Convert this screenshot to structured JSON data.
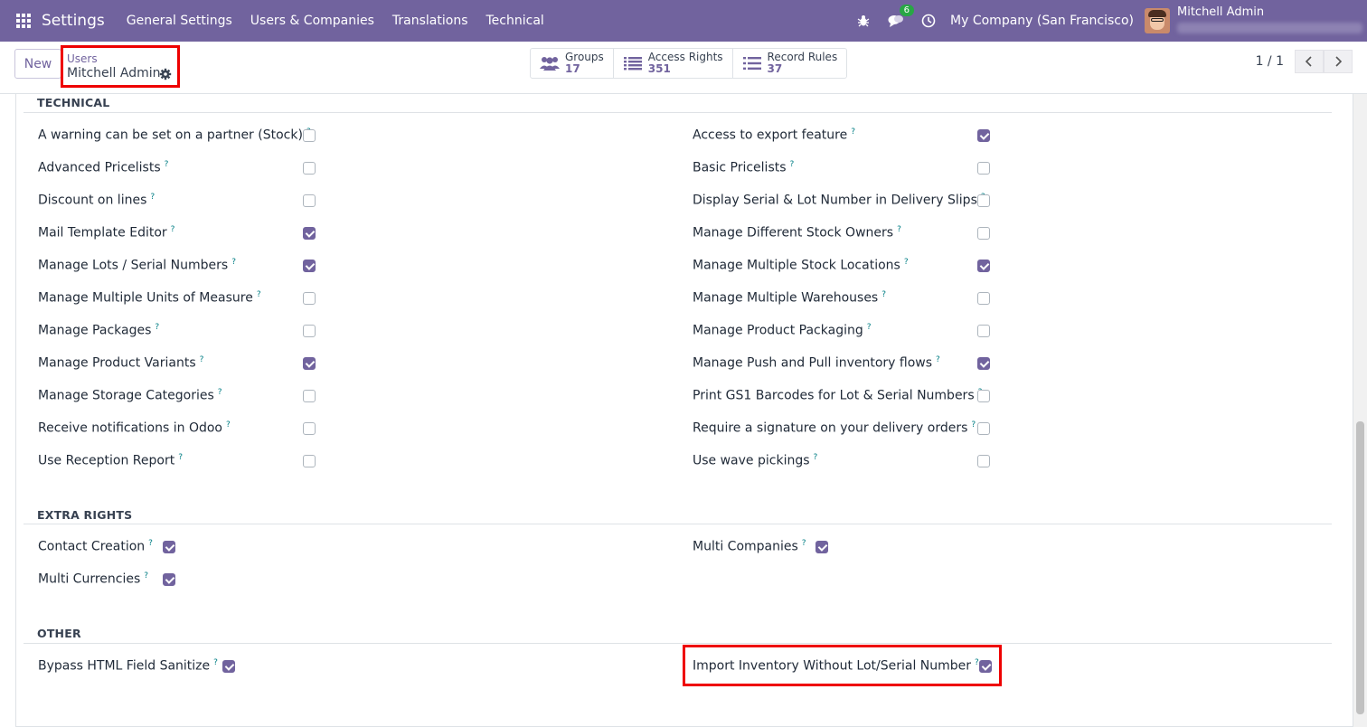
{
  "navbar": {
    "brand": "Settings",
    "menu": [
      "General Settings",
      "Users & Companies",
      "Translations",
      "Technical"
    ],
    "messages_badge": "6",
    "company": "My Company (San Francisco)",
    "user": "Mitchell Admin"
  },
  "control_panel": {
    "new_label": "New",
    "breadcrumb_parent": "Users",
    "breadcrumb_current": "Mitchell Admin",
    "smart_buttons": [
      {
        "label": "Groups",
        "value": "17",
        "icon": "users-icon"
      },
      {
        "label": "Access Rights",
        "value": "351",
        "icon": "list-icon"
      },
      {
        "label": "Record Rules",
        "value": "37",
        "icon": "list-icon"
      }
    ],
    "pager": "1 / 1"
  },
  "sections": {
    "technical": {
      "title": "TECHNICAL",
      "left": [
        {
          "label": "A warning can be set on a partner (Stock)",
          "checked": false
        },
        {
          "label": "Advanced Pricelists",
          "checked": false
        },
        {
          "label": "Discount on lines",
          "checked": false
        },
        {
          "label": "Mail Template Editor",
          "checked": true
        },
        {
          "label": "Manage Lots / Serial Numbers",
          "checked": true
        },
        {
          "label": "Manage Multiple Units of Measure",
          "checked": false
        },
        {
          "label": "Manage Packages",
          "checked": false
        },
        {
          "label": "Manage Product Variants",
          "checked": true
        },
        {
          "label": "Manage Storage Categories",
          "checked": false
        },
        {
          "label": "Receive notifications in Odoo",
          "checked": false
        },
        {
          "label": "Use Reception Report",
          "checked": false
        }
      ],
      "right": [
        {
          "label": "Access to export feature",
          "checked": true
        },
        {
          "label": "Basic Pricelists",
          "checked": false
        },
        {
          "label": "Display Serial & Lot Number in Delivery Slips",
          "checked": false
        },
        {
          "label": "Manage Different Stock Owners",
          "checked": false
        },
        {
          "label": "Manage Multiple Stock Locations",
          "checked": true
        },
        {
          "label": "Manage Multiple Warehouses",
          "checked": false
        },
        {
          "label": "Manage Product Packaging",
          "checked": false
        },
        {
          "label": "Manage Push and Pull inventory flows",
          "checked": true
        },
        {
          "label": "Print GS1 Barcodes for Lot & Serial Numbers",
          "checked": false
        },
        {
          "label": "Require a signature on your delivery orders",
          "checked": false
        },
        {
          "label": "Use wave pickings",
          "checked": false
        }
      ]
    },
    "extra_rights": {
      "title": "EXTRA RIGHTS",
      "left": [
        {
          "label": "Contact Creation",
          "checked": true
        },
        {
          "label": "Multi Currencies",
          "checked": true
        }
      ],
      "right": [
        {
          "label": "Multi Companies",
          "checked": true
        }
      ]
    },
    "other": {
      "title": "OTHER",
      "left": [
        {
          "label": "Bypass HTML Field Sanitize",
          "checked": true
        }
      ],
      "right": [
        {
          "label": "Import Inventory Without Lot/Serial Number",
          "checked": true
        }
      ]
    }
  },
  "help_marker": "?"
}
